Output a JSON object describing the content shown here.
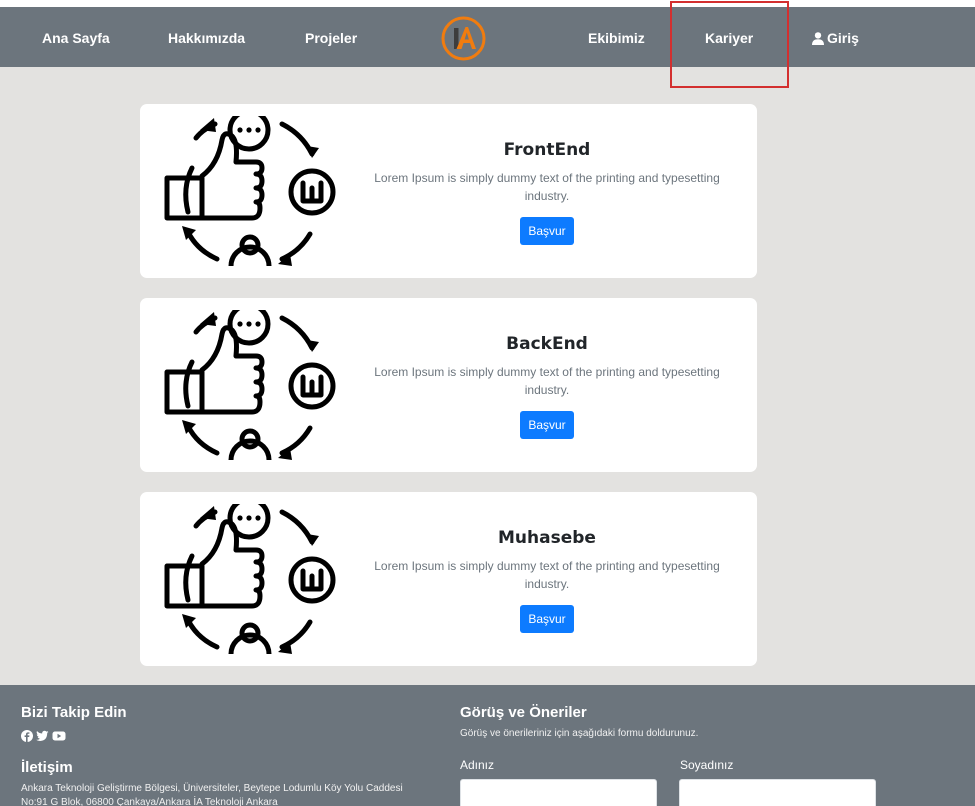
{
  "nav": {
    "items": [
      "Ana Sayfa",
      "Hakkımızda",
      "Projeler",
      "Ekibimiz",
      "Kariyer"
    ],
    "login": "Giriş",
    "logo_text": "İA"
  },
  "cards": [
    {
      "title": "FrontEnd",
      "text": "Lorem Ipsum is simply dummy text of the printing and typesetting industry.",
      "button": "Başvur"
    },
    {
      "title": "BackEnd",
      "text": "Lorem Ipsum is simply dummy text of the printing and typesetting industry.",
      "button": "Başvur"
    },
    {
      "title": "Muhasebe",
      "text": "Lorem Ipsum is simply dummy text of the printing and typesetting industry.",
      "button": "Başvur"
    }
  ],
  "footer": {
    "follow_title": "Bizi Takip Edin",
    "social_icons": [
      "facebook-icon",
      "twitter-icon",
      "youtube-icon"
    ],
    "contact_title": "İletişim",
    "address_line1": "Ankara Teknoloji Geliştirme Bölgesi, Üniversiteler, Beytepe Lodumlu Köy Yolu Caddesi",
    "address_line2": "No:91 G Blok, 06800 Çankaya/Ankara İA Teknoloji Ankara",
    "feedback_title": "Görüş ve Öneriler",
    "feedback_desc": "Görüş ve önerileriniz için aşağıdaki formu doldurunuz.",
    "first_name_label": "Adınız",
    "last_name_label": "Soyadınız"
  },
  "colors": {
    "navbar": "#6c757d",
    "page_bg": "#e3e2e0",
    "button": "#0d7bff",
    "logo_accent": "#f07c0f",
    "highlight": "#d32f2f"
  }
}
